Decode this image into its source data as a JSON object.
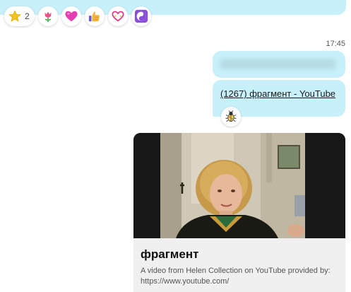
{
  "reactions": [
    {
      "icon": "star-icon",
      "count": "2"
    },
    {
      "icon": "tulip-icon"
    },
    {
      "icon": "heart-icon"
    },
    {
      "icon": "thumbs-up-icon"
    },
    {
      "icon": "heart-outline-icon"
    },
    {
      "icon": "yin-yang-icon"
    }
  ],
  "timestamp": "17:45",
  "link_message": {
    "text": "(1267) фрагмент - YouTube"
  },
  "bubble_reaction": {
    "icon": "bug-icon"
  },
  "preview": {
    "title": "фрагмент",
    "description": "A video from Helen Collection on YouTube provided by: https://www.youtube.com/"
  },
  "colors": {
    "bubble": "#c8f0fa",
    "card": "#f0f0f0"
  }
}
